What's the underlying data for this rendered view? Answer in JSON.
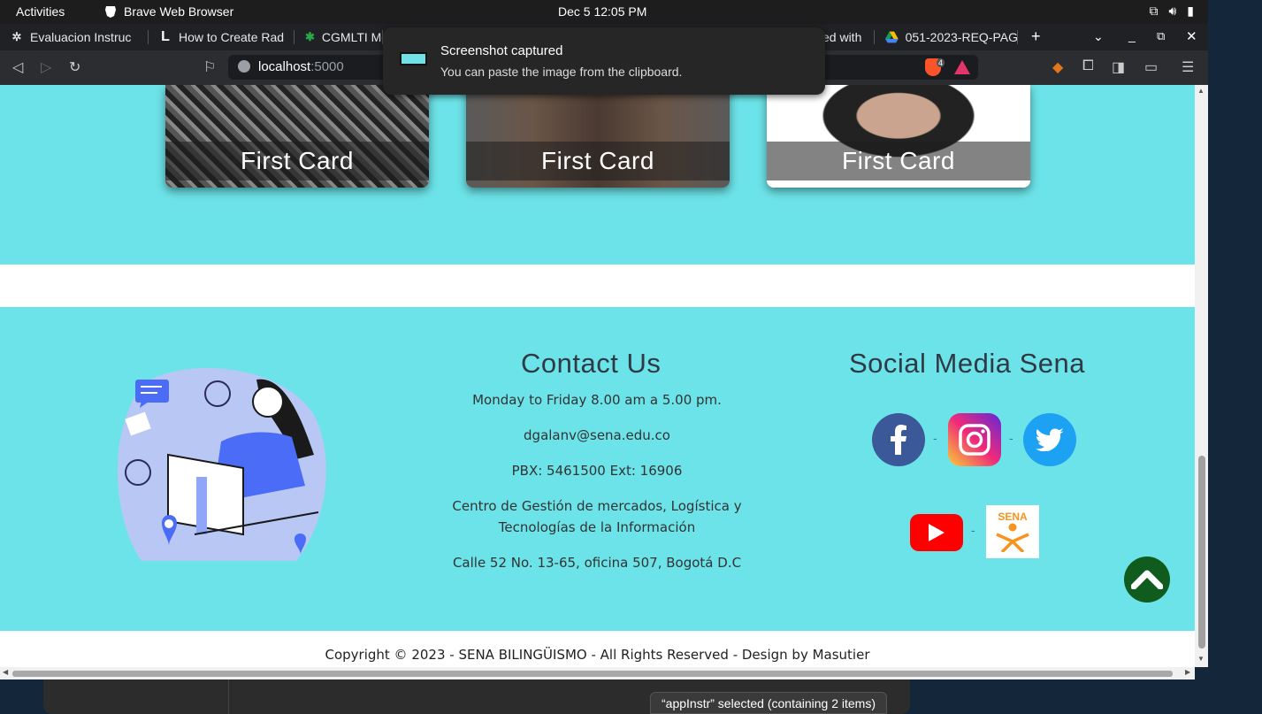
{
  "topbar": {
    "activities": "Activities",
    "app_name": "Brave Web Browser",
    "clock": "Dec 5  12:05 PM"
  },
  "tabs": [
    {
      "label": "Evaluacion Instruc",
      "icon": "sena-icon"
    },
    {
      "label": "How to Create Rad",
      "icon": "L"
    },
    {
      "label": "CGMLTI Mc",
      "icon": "star-icon"
    },
    {
      "label": "ed with",
      "icon": ""
    },
    {
      "label": "051-2023-REQ-PAG",
      "icon": "google-drive-icon"
    }
  ],
  "notification": {
    "title": "Screenshot captured",
    "body": "You can paste the image from the clipboard."
  },
  "address": {
    "host": "localhost",
    "port": ":5000",
    "shield_count": "4"
  },
  "cards": [
    {
      "caption": "First Card"
    },
    {
      "caption": "First Card"
    },
    {
      "caption": "First Card"
    }
  ],
  "footer": {
    "contact_title": "Contact Us",
    "hours": "Monday to Friday 8.00 am a 5.00 pm.",
    "email": "dgalanv@sena.edu.co",
    "pbx": "PBX: 5461500 Ext: 16906",
    "center_line1": "Centro de Gestión de mercados, Logística y",
    "center_line2": "Tecnologías de la Información",
    "address": "Calle 52 No. 13-65, oficina 507, Bogotá D.C",
    "social_title": "Social Media Sena",
    "social_icons": [
      "facebook-icon",
      "instagram-icon",
      "twitter-icon",
      "youtube-icon",
      "sena-logo-icon"
    ],
    "separator": "-",
    "sena_logo_text": "SENA",
    "copyright": "Copyright © 2023 - SENA BILINGÜISMO - All Rights Reserved - Design by Masutier"
  },
  "file_manager": {
    "status": "“appInstr” selected  (containing 2 items)"
  },
  "colors": {
    "page_bg": "#6ce3e8",
    "scroll_top_button": "#0f5c1e",
    "brave_orange": "#fb542b"
  }
}
